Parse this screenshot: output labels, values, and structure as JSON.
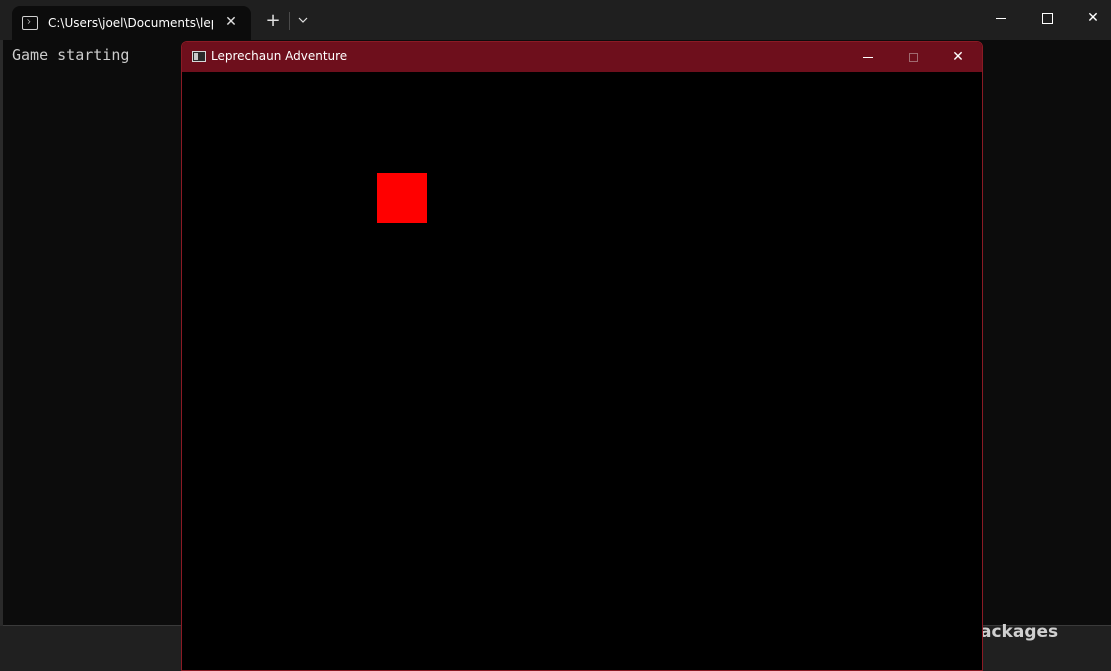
{
  "terminal": {
    "tab_title": "C:\\Users\\joel\\Documents\\leprechaun",
    "tab_close": "✕",
    "new_tab": "+",
    "dropdown": "⌄",
    "close_glyph": "✕",
    "output": "Game starting"
  },
  "background": {
    "partial_text": "ackages"
  },
  "game_window": {
    "title": "Leprechaun Adventure",
    "close_glyph": "✕",
    "player_color": "#ff0000",
    "titlebar_color": "#6e0f1c"
  },
  "icons": {
    "terminal_tab": "terminal-icon",
    "game_window": "app-window-icon"
  }
}
